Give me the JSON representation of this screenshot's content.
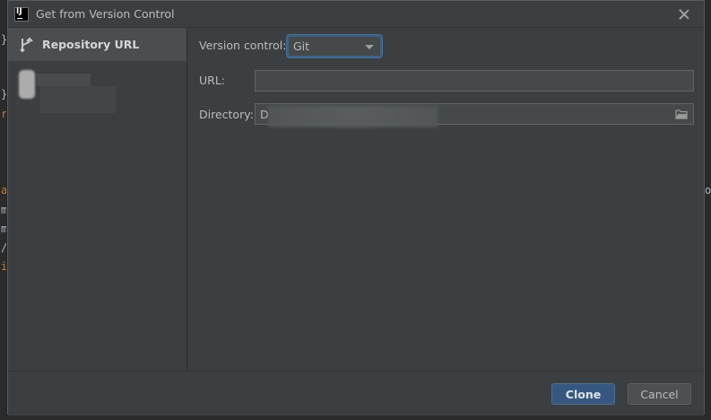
{
  "window": {
    "title": "Get from Version Control",
    "app_icon": "intellij-icon",
    "close_icon": "close-icon"
  },
  "sidebar": {
    "items": [
      {
        "label": "Repository URL",
        "icon": "vcs-branch-icon",
        "active": true
      }
    ]
  },
  "form": {
    "version_control": {
      "label": "Version control:",
      "value": "Git"
    },
    "url": {
      "label": "URL:",
      "value": ""
    },
    "directory": {
      "label": "Directory:",
      "value": "D",
      "icon": "folder-icon"
    }
  },
  "footer": {
    "clone_label": "Clone",
    "cancel_label": "Cancel"
  },
  "background": {
    "glyphs_left": [
      "}",
      "}",
      "r",
      "a",
      "m",
      "m",
      "/",
      "i"
    ],
    "glyphs_right": [
      "o"
    ]
  },
  "colors": {
    "dialog_bg": "#3c3f41",
    "accent": "#365880",
    "focus_border": "#3d6185"
  }
}
